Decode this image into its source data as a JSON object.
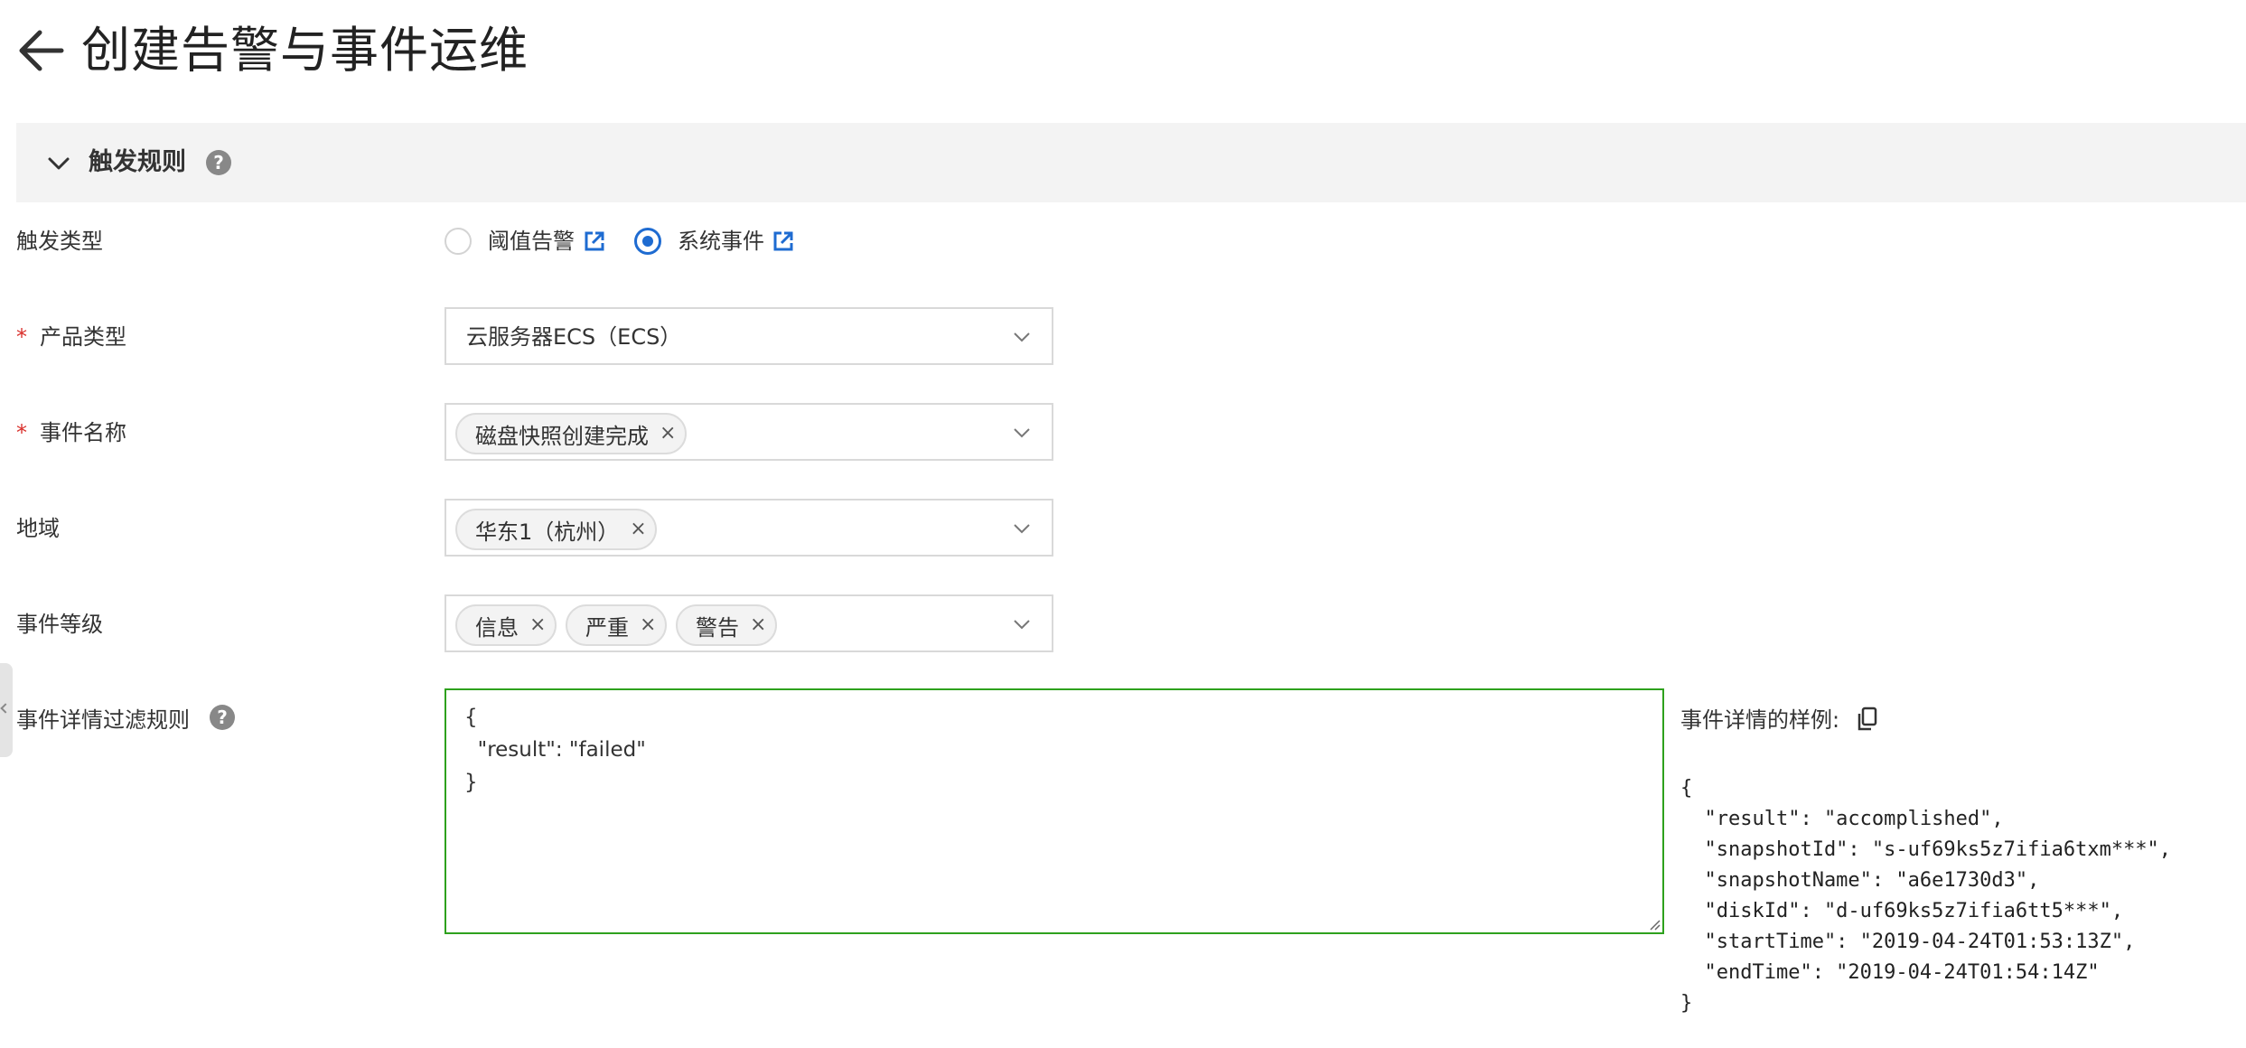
{
  "header": {
    "title": "创建告警与事件运维"
  },
  "section": {
    "title": "触发规则",
    "help": "?"
  },
  "form": {
    "trigger_type": {
      "label": "触发类型",
      "options": [
        {
          "label": "阈值告警",
          "selected": false
        },
        {
          "label": "系统事件",
          "selected": true
        }
      ]
    },
    "product_type": {
      "required_mark": "*",
      "label": "产品类型",
      "value": "云服务器ECS（ECS）"
    },
    "event_name": {
      "required_mark": "*",
      "label": "事件名称",
      "tags": [
        "磁盘快照创建完成"
      ]
    },
    "region": {
      "label": "地域",
      "tags": [
        "华东1（杭州）"
      ]
    },
    "event_level": {
      "label": "事件等级",
      "tags": [
        "信息",
        "严重",
        "警告"
      ]
    },
    "filter_rule": {
      "label": "事件详情过滤规则",
      "help": "?",
      "value": "{\n  \"result\": \"failed\"\n}"
    },
    "sample": {
      "label": "事件详情的样例:",
      "code": "{\n  \"result\": \"accomplished\",\n  \"snapshotId\": \"s-uf69ks5z7ifia6txm***\",\n  \"snapshotName\": \"a6e1730d3\",\n  \"diskId\": \"d-uf69ks5z7ifia6tt5***\",\n  \"startTime\": \"2019-04-24T01:53:13Z\",\n  \"endTime\": \"2019-04-24T01:54:14Z\"\n}"
    }
  },
  "icons": {
    "tag_close": "×"
  },
  "colors": {
    "accent_blue": "#1e6bd1",
    "required_red": "#d9302c",
    "active_border_green": "#2ea11d",
    "section_bg": "#f3f3f3"
  }
}
